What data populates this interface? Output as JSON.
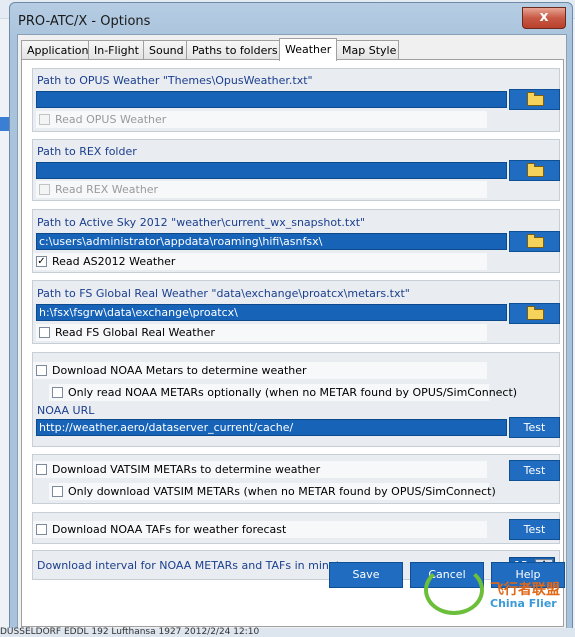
{
  "window": {
    "title": "PRO-ATC/X - Options",
    "close_label": "x"
  },
  "tabs": [
    "Application",
    "In-Flight",
    "Sound",
    "Paths to folders",
    "Weather",
    "Map Style"
  ],
  "active_tab": "Weather",
  "opus": {
    "label": "Path to OPUS Weather \"Themes\\OpusWeather.txt\"",
    "path": "",
    "checkbox_label": "Read OPUS Weather",
    "checked": false,
    "enabled": false
  },
  "rex": {
    "label": "Path to REX folder",
    "path": "",
    "checkbox_label": "Read REX Weather",
    "checked": false,
    "enabled": false
  },
  "as2012": {
    "label": "Path to Active Sky 2012 \"weather\\current_wx_snapshot.txt\"",
    "path": "c:\\users\\administrator\\appdata\\roaming\\hifi\\asnfsx\\",
    "checkbox_label": "Read AS2012 Weather",
    "checked": true,
    "check_mark": "✓"
  },
  "fsgrw": {
    "label": "Path to FS Global Real Weather \"data\\exchange\\proatcx\\metars.txt\"",
    "path": "h:\\fsx\\fsgrw\\data\\exchange\\proatcx\\",
    "checkbox_label": "Read FS Global Real Weather",
    "checked": false
  },
  "noaa": {
    "download_label": "Download NOAA Metars to determine weather",
    "optional_label": "Only read NOAA METARs optionally (when no METAR found by OPUS/SimConnect)",
    "url_label": "NOAA URL",
    "url": "http://weather.aero/dataserver_current/cache/",
    "test_label": "Test"
  },
  "vatsim": {
    "download_label": "Download VATSIM METARs to determine weather",
    "optional_label": "Only download VATSIM METARs (when no METAR found by OPUS/SimConnect)",
    "test_label": "Test"
  },
  "taf": {
    "download_label": "Download NOAA TAFs for weather forecast",
    "test_label": "Test"
  },
  "interval": {
    "label": "Download interval for NOAA METARs and TAFs in minutes",
    "value": "15"
  },
  "footer": {
    "save_label": "Save",
    "cancel_label": "Cancel",
    "help_label": "Help"
  },
  "watermark": {
    "line1": "飞行者联盟",
    "line2": "China Flier"
  },
  "background_row": "DUSSELDORF      EDDL      192   Lufthansa      1927      2012/2/24      12:10"
}
